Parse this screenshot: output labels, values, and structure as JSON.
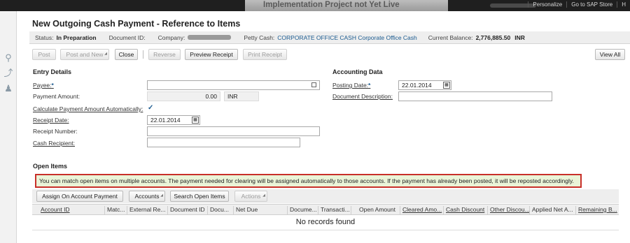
{
  "topbar": {
    "banner_text": "Implementation Project not Yet Live",
    "links": [
      "Personalize",
      "Go to SAP Store",
      "H"
    ]
  },
  "header": {
    "title": "New Outgoing Cash Payment - Reference to Items",
    "status_label": "Status:",
    "status_value": "In Preparation",
    "document_id_label": "Document ID:",
    "company_label": "Company:",
    "petty_cash_label": "Petty Cash:",
    "petty_cash_value": "CORPORATE OFFICE CASH Corporate Office Cash",
    "balance_label": "Current Balance:",
    "balance_value": "2,776,885.50",
    "balance_currency": "INR"
  },
  "toolbar": {
    "post": "Post",
    "post_and_new": "Post and New",
    "close": "Close",
    "reverse": "Reverse",
    "preview_receipt": "Preview Receipt",
    "print_receipt": "Print Receipt",
    "view_all": "View All"
  },
  "entry": {
    "section_title": "Entry Details",
    "payee_label": "Payee:",
    "payment_amount_label": "Payment Amount:",
    "payment_amount_value": "0.00",
    "payment_currency": "INR",
    "calc_auto_label": "Calculate Payment Amount Automatically:",
    "receipt_date_label": "Receipt Date:",
    "receipt_date_value": "22.01.2014",
    "receipt_number_label": "Receipt Number:",
    "cash_recipient_label": "Cash Recipient:"
  },
  "accounting": {
    "section_title": "Accounting Data",
    "posting_date_label": "Posting Date:",
    "posting_date_value": "22.01.2014",
    "document_description_label": "Document Description:"
  },
  "open_items": {
    "section_title": "Open Items",
    "message": "You can match open items on multiple accounts. The payment needed for clearing will be assigned automatically to those accounts. If the payment has already been posted, it will be reposted accordingly.",
    "buttons": {
      "assign": "Assign On Account Payment",
      "accounts": "Accounts",
      "search": "Search Open Items",
      "actions": "Actions"
    },
    "columns": [
      "Account ID",
      "Matc...",
      "External Re...",
      "Document ID",
      "Docu...",
      "Net Due",
      "Docume...",
      "Transacti...",
      "Open Amount",
      "Cleared Amo...",
      "Cash Discount",
      "Other Discou...",
      "Applied Net A...",
      "Remaining B..."
    ],
    "empty_text": "No records found"
  },
  "colors": {
    "accent": "#1a5a8f",
    "message_border": "#c8302a",
    "message_bg": "#eaf4d8"
  }
}
